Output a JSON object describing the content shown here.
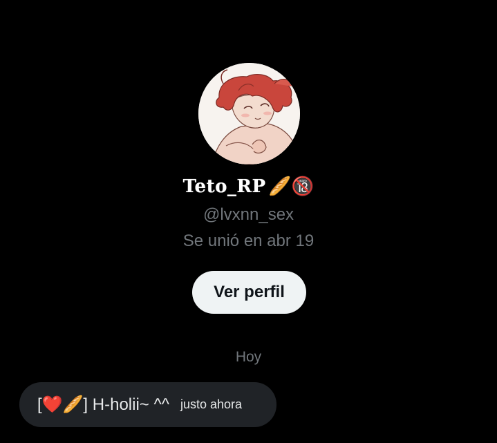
{
  "profile": {
    "display_name": "Teto_RP",
    "display_name_emoji": "🥖🔞",
    "handle": "@lvxnn_sex",
    "joined": "Se unió en abr 19",
    "view_profile_label": "Ver perfil"
  },
  "conversation": {
    "date_separator": "Hoy",
    "messages": [
      {
        "text": "[❤️🥖] H-holii~ ^^",
        "time": "justo ahora"
      }
    ]
  },
  "colors": {
    "background": "#000000",
    "secondary_text": "#71767b",
    "button_bg": "#eff3f4",
    "bubble_bg": "#202327"
  }
}
